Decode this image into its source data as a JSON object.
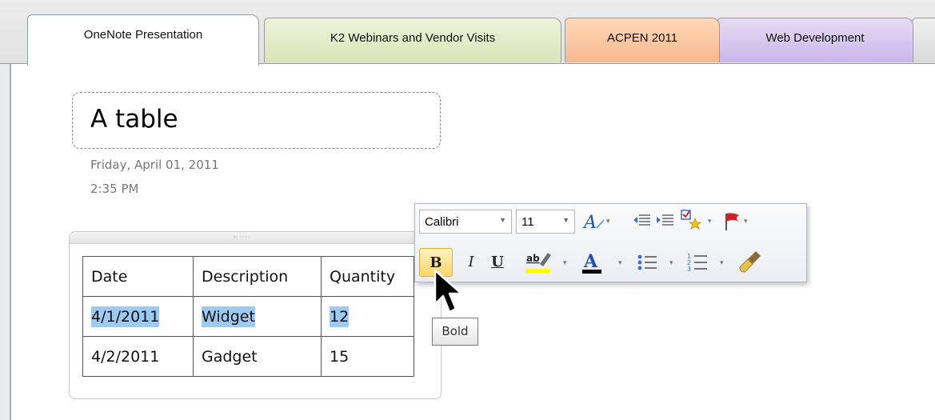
{
  "tabs": [
    {
      "label": "OneNote Presentation",
      "active": true
    },
    {
      "label": "K2 Webinars and Vendor Visits",
      "active": false
    },
    {
      "label": "ACPEN 2011",
      "active": false
    },
    {
      "label": "Web Development",
      "active": false
    }
  ],
  "page": {
    "title": "A table",
    "date": "Friday, April 01, 2011",
    "time": "2:35 PM"
  },
  "table": {
    "rows": [
      [
        "Date",
        "Description",
        "Quantity"
      ],
      [
        "4/1/2011",
        "Widget",
        "12"
      ],
      [
        "4/2/2011",
        "Gadget",
        "15"
      ]
    ],
    "selected_row": 1
  },
  "mini_toolbar": {
    "font": "Calibri",
    "size": "11",
    "bold_label": "B",
    "italic_label": "I",
    "underline_label": "U",
    "font_color_label": "A",
    "highlight_label": "ab"
  },
  "tooltip": "Bold",
  "colors": {
    "selection": "#9ec9f1",
    "highlight_bar": "#ffff00",
    "font_color_bar": "#000000",
    "bold_hover": "#ffd56a"
  }
}
